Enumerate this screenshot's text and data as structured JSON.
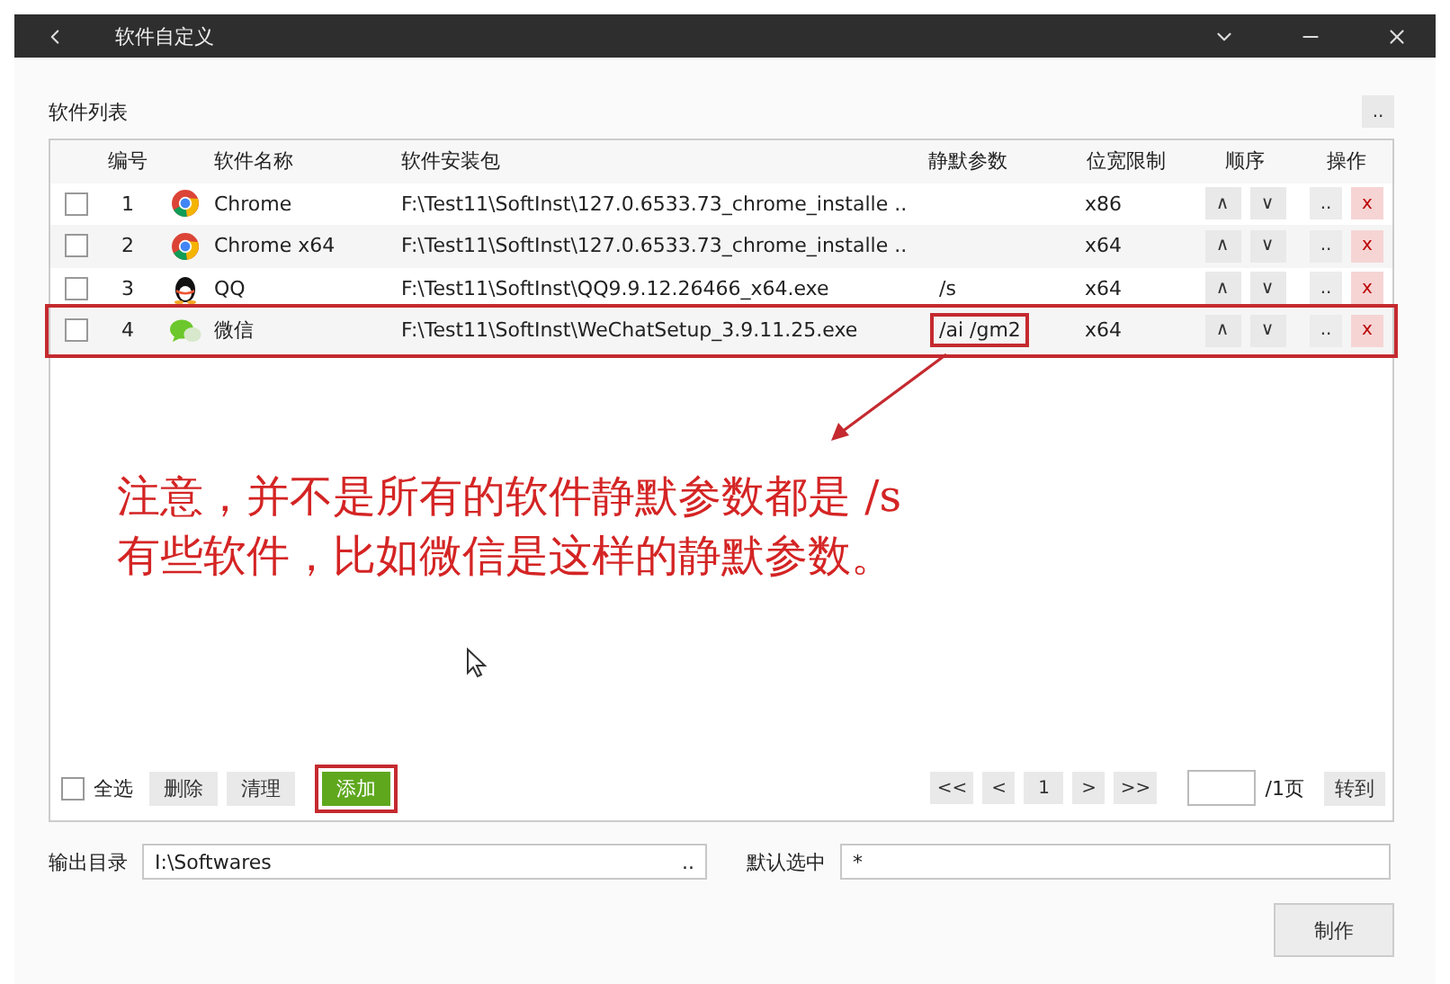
{
  "window": {
    "title": "软件自定义"
  },
  "list_panel": {
    "title": "软件列表",
    "menu_button": ".."
  },
  "table": {
    "columns": [
      "编号",
      "软件名称",
      "软件安装包",
      "静默参数",
      "位宽限制",
      "顺序",
      "操作"
    ],
    "rows": [
      {
        "checked": false,
        "number": "1",
        "kind": "chrome",
        "name": "Chrome",
        "package": "F:\\Test11\\SoftInst\\127.0.6533.73_chrome_installe ..",
        "params": "",
        "arch": "x86",
        "order_buttons": [
          "∧",
          "∨"
        ],
        "actions": [
          "..",
          "x"
        ],
        "annotated": false
      },
      {
        "checked": false,
        "number": "2",
        "kind": "chrome",
        "name": "Chrome x64",
        "package": "F:\\Test11\\SoftInst\\127.0.6533.73_chrome_installe ..",
        "params": "",
        "arch": "x64",
        "order_buttons": [
          "∧",
          "∨"
        ],
        "actions": [
          "..",
          "x"
        ],
        "annotated": false
      },
      {
        "checked": false,
        "number": "3",
        "kind": "penguin",
        "name": "QQ",
        "package": "F:\\Test11\\SoftInst\\QQ9.9.12.26466_x64.exe",
        "params": "/s",
        "arch": "x64",
        "order_buttons": [
          "∧",
          "∨"
        ],
        "actions": [
          "..",
          "x"
        ],
        "annotated": false
      },
      {
        "checked": false,
        "number": "4",
        "kind": "chat",
        "name": "微信",
        "package": "F:\\Test11\\SoftInst\\WeChatSetup_3.9.11.25.exe",
        "params": "/ai /gm2",
        "arch": "x64",
        "order_buttons": [
          "∧",
          "∨"
        ],
        "actions": [
          "..",
          "x"
        ],
        "annotated": true
      }
    ]
  },
  "annotation": {
    "lines": [
      "注意，并不是所有的软件静默参数都是 /s",
      "有些软件，比如微信是这样的静默参数。"
    ]
  },
  "footer": {
    "select_all": {
      "label": "全选",
      "checked": false
    },
    "buttons": [
      {
        "label": "删除",
        "kind": "plain",
        "annotated": false
      },
      {
        "label": "清理",
        "kind": "plain",
        "annotated": false
      },
      {
        "label": "添加",
        "kind": "primary",
        "annotated": true
      }
    ],
    "pager": [
      "<<",
      "<",
      "1",
      ">",
      ">>"
    ],
    "page_total": "/1页",
    "goto": "转到"
  },
  "output": {
    "label": "输出目录",
    "value": "I:\\Softwares",
    "browse": ".."
  },
  "default_select": {
    "label": "默认选中",
    "value": "*"
  },
  "make_button": "制作"
}
